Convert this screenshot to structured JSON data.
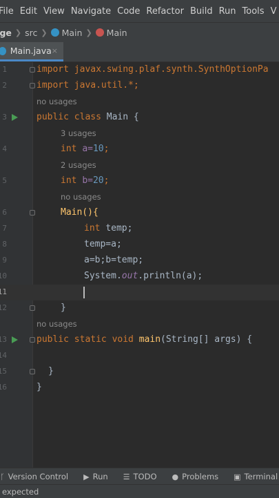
{
  "menu": [
    "File",
    "Edit",
    "View",
    "Navigate",
    "Code",
    "Refactor",
    "Build",
    "Run",
    "Tools",
    "V"
  ],
  "breadcrumb": {
    "project": "ege",
    "folder": "src",
    "file": "Main",
    "symbol": "Main",
    "file_icon_color": "#3592c4",
    "symbol_icon_color": "#c75450"
  },
  "tab": {
    "label": "Main.java",
    "close": "×"
  },
  "lines": {
    "l1": {
      "num": "1",
      "t": "import javax.swing.plaf.synth.SynthOptionPa"
    },
    "l2": {
      "num": "2",
      "t": "import java.util.*;"
    },
    "h3": "no usages",
    "l3": {
      "num": "3",
      "kw": "public class ",
      "name": "Main",
      "rest": " {"
    },
    "h4": "3 usages",
    "l4": {
      "num": "4",
      "kw": "int ",
      "var": "a=",
      "val": "10",
      "end": ";"
    },
    "h5": "2 usages",
    "l5": {
      "num": "5",
      "kw": "int ",
      "var": "b=",
      "val": "20",
      "end": ";"
    },
    "h6": "no usages",
    "l6": {
      "num": "6",
      "t": "Main(){"
    },
    "l7": {
      "num": "7",
      "kw": "int ",
      "t": "temp;"
    },
    "l8": {
      "num": "8",
      "t": "temp=a;"
    },
    "l9": {
      "num": "9",
      "t": "a=b;b=temp;"
    },
    "l10": {
      "num": "10",
      "pre": "System.",
      "fld": "out",
      "post": ".println(a);"
    },
    "l11": {
      "num": "11"
    },
    "l12": {
      "num": "12",
      "t": "}"
    },
    "h13": "no usages",
    "l13": {
      "num": "13",
      "kw": "public static void ",
      "fn": "main",
      "rest": "(String[] args) {"
    },
    "l14": {
      "num": "14"
    },
    "l15": {
      "num": "15",
      "t": "}"
    },
    "l16": {
      "num": "16",
      "t": "}"
    }
  },
  "toolbar": {
    "version_control": "Version Control",
    "run": "Run",
    "todo": "TODO",
    "problems": "Problems",
    "terminal": "Terminal"
  },
  "status": {
    "text": "expected"
  },
  "colors": {
    "keyword": "#cc7832",
    "number": "#6897bb",
    "method": "#ffc66d",
    "field": "#9876aa",
    "run_gutter": "#499c54"
  }
}
